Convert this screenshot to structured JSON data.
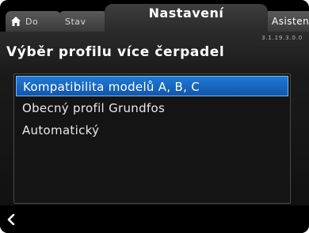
{
  "tabs": {
    "home": "Do",
    "status": "Stav",
    "settings": "Nastavení",
    "assist": "Asisten"
  },
  "header": {
    "title": "Výběr profilu více čerpadel",
    "code": "3.1.19.3.0.0"
  },
  "list": {
    "items": [
      {
        "label": "Kompatibilita modelů A, B, C",
        "selected": true
      },
      {
        "label": "Obecný profil Grundfos",
        "selected": false
      },
      {
        "label": "Automatický",
        "selected": false
      }
    ]
  },
  "icons": {
    "home": "home-icon",
    "back": "back-arrow-icon"
  },
  "colors": {
    "selection": "#1d6fc8",
    "background": "#000000"
  }
}
